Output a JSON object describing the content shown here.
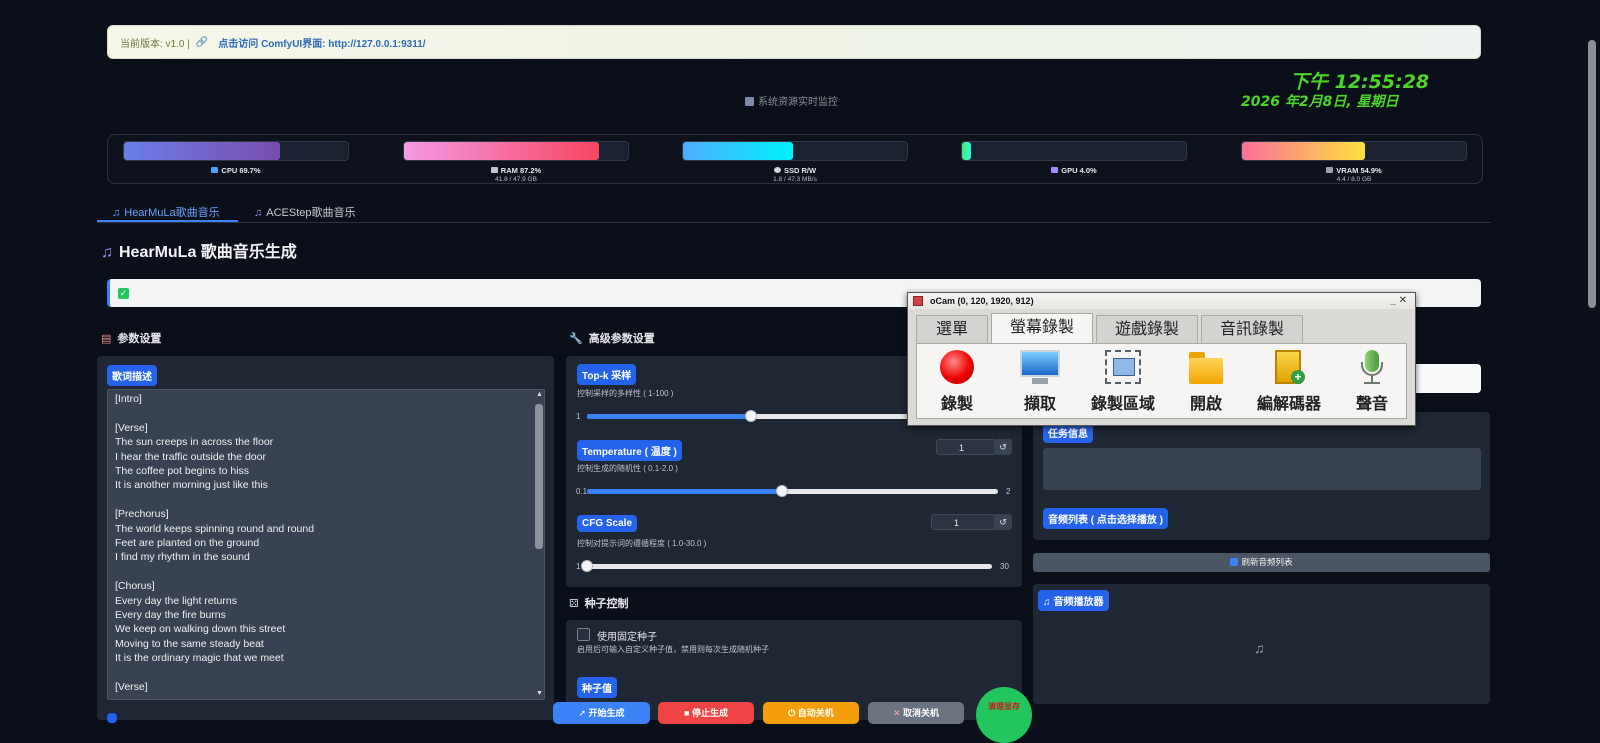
{
  "topbar": {
    "version": "当前版本: v1.0 |",
    "link_text": "点击访问 ComfyUI界面: http://127.0.0.1:9311/"
  },
  "monitor": {
    "title": "系统资源实时监控"
  },
  "clock": {
    "time": "下午 12:55:28",
    "date": "2026 年2月8日, 星期日"
  },
  "resources": [
    {
      "label": "CPU 69.7%",
      "sub": "",
      "percent": 69.7,
      "color_from": "#6a7ee8",
      "color_to": "#7a4cae"
    },
    {
      "label": "RAM 87.2%",
      "sub": "41.8 / 47.9 GB",
      "percent": 87.2,
      "color_from": "#f59ae8",
      "color_to": "#f5475e"
    },
    {
      "label": "SSD R/W",
      "sub": "1.8 / 47.3 MB/s",
      "percent": 49,
      "color_from": "#4facfe",
      "color_to": "#00f2fe"
    },
    {
      "label": "GPU 4.0%",
      "sub": "",
      "percent": 4,
      "color_from": "#43e97b",
      "color_to": "#38f9d7"
    },
    {
      "label": "VRAM 54.9%",
      "sub": "4.4 / 8.0 GB",
      "percent": 54.9,
      "color_from": "#fa709a",
      "color_to": "#fee140"
    }
  ],
  "tabs": [
    {
      "label": "HearMuLa歌曲音乐"
    },
    {
      "label": "ACEStep歌曲音乐"
    }
  ],
  "page_title": "HearMuLa 歌曲音乐生成",
  "params": {
    "heading": "参数设置",
    "lyrics_label": "歌词描述",
    "lyrics": [
      "[Intro]",
      "",
      "[Verse]",
      "The sun creeps in across the floor",
      "I hear the traffic outside the door",
      "The coffee pot begins to hiss",
      "It is another morning just like this",
      "",
      "[Prechorus]",
      "The world keeps spinning round and round",
      "Feet are planted on the ground",
      "I find my rhythm in the sound",
      "",
      "[Chorus]",
      "Every day the light returns",
      "Every day the fire burns",
      "We keep on walking down this street",
      "Moving to the same steady beat",
      "It is the ordinary magic that we meet",
      "",
      "[Verse]"
    ]
  },
  "advanced": {
    "heading": "高级参数设置",
    "topk": {
      "label": "Top-k 采样",
      "desc": "控制采样的多样性 ( 1-100 )",
      "min": "1",
      "value": 50,
      "min_v": 1,
      "max_v": 100
    },
    "temperature": {
      "label": "Temperature ( 温度 )",
      "desc": "控制生成的随机性 ( 0.1-2.0 )",
      "min": "0.1",
      "max": "2",
      "value": "1",
      "value_num": 1.0,
      "min_v": 0.1,
      "max_v": 2.0
    },
    "cfg": {
      "label": "CFG Scale",
      "desc": "控制对提示词的遵循程度 ( 1.0-30.0 )",
      "min": "1",
      "max": "30",
      "value": "1",
      "value_num": 1,
      "min_v": 1,
      "max_v": 30
    },
    "reset_icon": "↺"
  },
  "seed": {
    "heading": "种子控制",
    "checkbox_label": "使用固定种子",
    "checkbox_desc": "启用后可输入自定义种子值，禁用则每次生成随机种子",
    "value_label": "种子值"
  },
  "right": {
    "task_label": "任务信息",
    "audio_list_label": "音频列表 ( 点击选择播放 )",
    "refresh_label": "刷新音频列表",
    "player_label": "音频播放器",
    "music_icon": "♫"
  },
  "bottom_buttons": [
    {
      "label": "开始生成",
      "color": "#3b82f6"
    },
    {
      "label": "停止生成",
      "color": "#ef4444"
    },
    {
      "label": "自动关机",
      "color": "#f59e0b"
    },
    {
      "label": "取消关机",
      "color": "#6b7280"
    }
  ],
  "fab": {
    "label": "清理显存"
  },
  "ocam": {
    "title": "oCam (0, 120, 1920, 912)",
    "tabs": [
      "選單",
      "螢幕錄製",
      "遊戲錄製",
      "音訊錄製"
    ],
    "tools": [
      "錄製",
      "擷取",
      "錄製區域",
      "開啟",
      "編解碼器",
      "聲音"
    ],
    "window_controls": "_ ✕"
  }
}
